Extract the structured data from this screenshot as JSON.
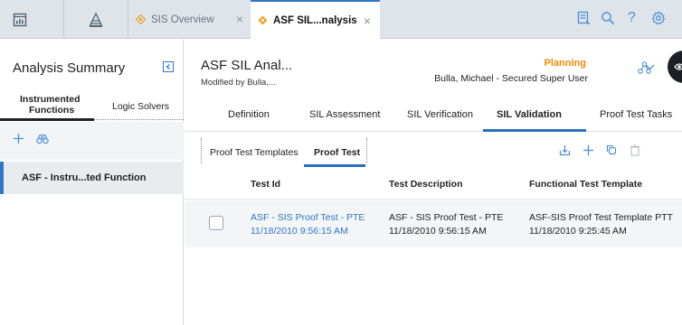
{
  "topbar": {
    "tabs": [
      {
        "label": "SIS Overview",
        "active": false
      },
      {
        "label": "ASF SIL...nalysis",
        "active": true
      }
    ],
    "close_glyph": "×",
    "left_icons": [
      "dashboard-icon",
      "sil-pyramid-icon"
    ],
    "right_icons": [
      "notes-icon",
      "search-icon",
      "help-icon",
      "settings-icon"
    ],
    "help_glyph": "?"
  },
  "left_panel": {
    "title": "Analysis Summary",
    "tabs": [
      {
        "label_line1": "Instrumented",
        "label_line2": "Functions",
        "active": true
      },
      {
        "label": "Logic Solvers",
        "active": false
      }
    ],
    "tools": [
      "add-icon",
      "binoculars-icon"
    ],
    "items": [
      {
        "label": "ASF - Instru...ted Function",
        "selected": true
      }
    ]
  },
  "header": {
    "title": "ASF SIL Anal...",
    "subtitle": "Modified by Bulla,...",
    "state": "Planning",
    "user": "Bulla, Michael - Secured Super User"
  },
  "main_tabs": [
    {
      "label": "Definition",
      "active": false
    },
    {
      "label": "SIL Assessment",
      "active": false
    },
    {
      "label": "SIL Verification",
      "active": false
    },
    {
      "label": "SIL Validation",
      "active": true
    },
    {
      "label": "Proof Test Tasks",
      "active": false
    }
  ],
  "sub_tabs": [
    {
      "label": "Proof Test Templates",
      "active": false
    },
    {
      "label": "Proof Test",
      "active": true
    }
  ],
  "table": {
    "columns": [
      "Test Id",
      "Test Description",
      "Functional Test Template"
    ],
    "rows": [
      {
        "test_id": [
          "ASF - SIS Proof Test - PTE",
          "11/18/2010 9:56:15 AM"
        ],
        "description": [
          "ASF - SIS Proof Test - PTE",
          "11/18/2010 9:56:15 AM"
        ],
        "template": [
          "ASF-SIS Proof Test Template PTT",
          "11/18/2010 9:25:45 AM"
        ]
      }
    ]
  },
  "colors": {
    "accent": "#2f77c6",
    "state_orange": "#f08a00",
    "topbar_bg": "#dfe4ea"
  }
}
